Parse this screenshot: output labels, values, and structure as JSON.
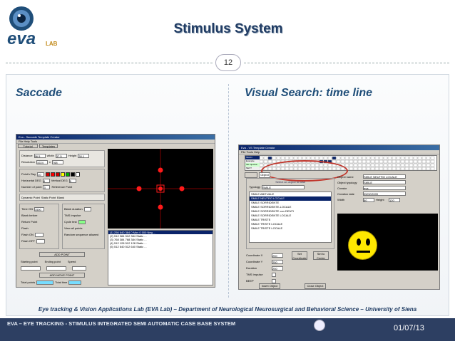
{
  "header": {
    "logo_text": "eva",
    "logo_sub": "LAB",
    "title": "Stimulus System",
    "page_number": "12"
  },
  "sections": {
    "left_label": "Saccade",
    "right_label": "Visual Search: time line"
  },
  "saccade_window": {
    "title": "Eva - Saccade Template Creator",
    "menu": "File  Help  Tools",
    "tabs": [
      "Tutorial experiment",
      "Templates data"
    ],
    "fields": [
      {
        "label": "Distance",
        "value": "56.5"
      },
      {
        "label": "Width",
        "value": "37.5"
      },
      {
        "label": "Height",
        "value": "30.1"
      },
      {
        "label": "Resolution",
        "value": "1024"
      },
      {
        "label": "x",
        "value": "768"
      }
    ],
    "point_ray_label": "Point's Ray",
    "point_ray_value": "10",
    "horizontal_label": "Horizontal DEG",
    "horizontal_value": "8",
    "vertical_label": "Vertical DEG",
    "vertical_value": "5",
    "number_points_label": "Number of point",
    "number_points_value": "3",
    "reference_label": "Reference Point",
    "dynamic_label": "Dynamic Point",
    "static_label": "Static Point",
    "blank_label": "Blank",
    "time_on_label": "Time ON",
    "time_on_value": "1500",
    "blank_duration_label": "Blank duration",
    "blank_before": "Blank before",
    "return_point": "Return Point",
    "tms_impulse": "TMS impulse",
    "flash_label": "Flash",
    "flash_on": "Flash ON",
    "flash_off": "Flash OFF",
    "n_flash": "N° of flash",
    "cycle_test": "Cycle test",
    "view_all": "View all points",
    "random_seq": "Random sequence allowed",
    "add_point": "ADD POINT",
    "starting_point": "Starting point",
    "ending_point": "Ending point",
    "speed": "Speed",
    "add_move_point": "ADD MOVE POINT",
    "total_points": "Total points",
    "total_time": "Total time",
    "log_lines": [
      "(1) 256 640 384 0 Mov 0 000 Neg ...",
      "(2) 512 384 512 384 Static ...",
      "(3) 768 384 768 384 Static ...",
      "(4) 512 128 512 128 Static ...",
      "(5) 512 640 512 640 Static ..."
    ],
    "colors": [
      "#cc0000",
      "#ff0000",
      "#cc0000",
      "#ffff00",
      "#00aa00",
      "#000000",
      "#ffffff"
    ]
  },
  "search_window": {
    "title": "Eva - VS Template Creator",
    "menu": "File  Tools  Help",
    "tab": "Object",
    "track_labels": [
      "SM-IN",
      "Example",
      "Slit Injection",
      "NEXT"
    ],
    "select_label": "Select an object to load",
    "typology_label": "Typology",
    "typology_value": "SMILE",
    "list_items": [
      "SMILE ABITUALE",
      "SMILE NEUTRO LOCALE",
      "SMILE SORRIDENTE",
      "SMILE SORRIDENTE-LOCALE",
      "SMILE SORRIDENTE con DENTI",
      "SMILE SORRIDENTE LOCALE",
      "SMILE TRISTE",
      "SMILE TRISTE LOCALE",
      "SMILE TRISTE LOCALE"
    ],
    "object_props": [
      {
        "label": "Object name",
        "value": "SMILE NEUTRO LOCALE"
      },
      {
        "label": "Object typology",
        "value": "SMILE"
      },
      {
        "label": "Creator",
        "value": "eva"
      },
      {
        "label": "Creation date",
        "value": "05/02/2009"
      },
      {
        "label": "Width",
        "value": "80"
      },
      {
        "label": "Height",
        "value": "120"
      }
    ],
    "coord_x_label": "Coordinate X",
    "coord_x_value": "250",
    "coord_y_label": "Coordinate Y",
    "coord_y_value": "250",
    "duration_label": "Duration",
    "duration_value": "250",
    "tms_label": "TMS Impulse",
    "beep_label": "BEEP",
    "set_coords": "Set Coordinate",
    "set_center": "Set to Center",
    "insert_object": "Insert Object",
    "close_object": "Close Object"
  },
  "footer": {
    "credit": "Eye tracking & Vision Applications Lab (EVA Lab) – Department of Neurological Neurosurgical and Behavioral Science – University of Siena",
    "system": "EVA – EYE TRACKING - STIMULUS INTEGRATED SEMI AUTOMATIC CASE BASE SYSTEM",
    "date": "01/07/13"
  }
}
